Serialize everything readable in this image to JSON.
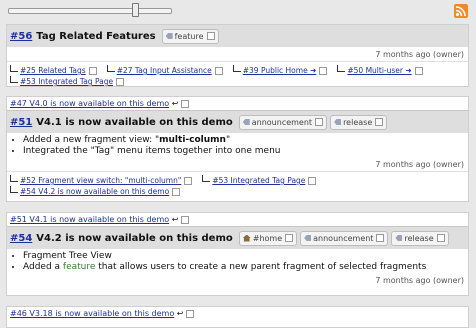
{
  "feed": {
    "slider": {
      "value": 0.78
    },
    "items": [
      {
        "id": "#56",
        "title": "Tag Related Features",
        "tags": [
          "feature"
        ],
        "meta": "7 months ago (owner)",
        "related": [
          "#25 Related Tags",
          "#27 Tag Input Assistance",
          "#39 Public Home ➜",
          "#50 Multi-user ➜",
          "#53 Integrated Tag Page"
        ]
      },
      {
        "ref": "#47 V4.0 is now available on this demo",
        "id": "#51",
        "title": "V4.1 is now available on this demo",
        "tags": [
          "announcement",
          "release"
        ],
        "bullets": [
          {
            "pre": "Added a new fragment view: \"",
            "bold": "multi-column",
            "post": "\""
          },
          {
            "pre": "Integrated the \"Tag\" menu items together into one menu",
            "bold": "",
            "post": ""
          }
        ],
        "meta": "7 months ago (owner)",
        "related": [
          "#52 Fragment view switch: \"multi-column\"",
          "#53 Integrated Tag Page",
          "#54 V4.2 is now available on this demo"
        ]
      },
      {
        "ref": "#51 V4.1 is now available on this demo",
        "id": "#54",
        "title": "V4.2 is now available on this demo",
        "tags": [
          "#home",
          "announcement",
          "release"
        ],
        "bullets": [
          {
            "pre": "Fragment Tree View",
            "bold": "",
            "post": ""
          },
          {
            "pre": "Added a ",
            "link": "feature",
            "post": " that allows users to create a new parent fragment of selected fragments"
          }
        ],
        "meta": "7 months ago (owner)"
      },
      {
        "ref": "#46 V3.18 is now available on this demo"
      }
    ]
  }
}
